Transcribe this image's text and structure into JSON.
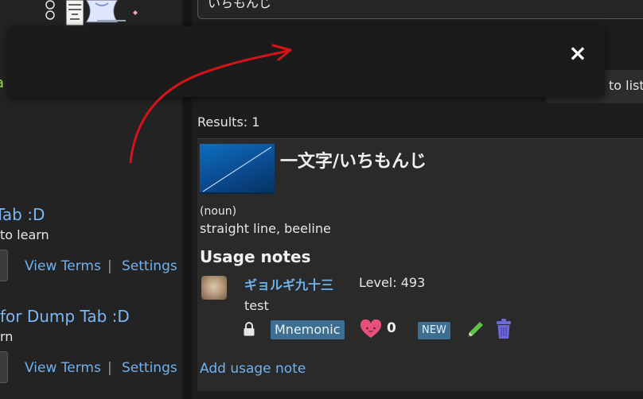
{
  "search": {
    "value": "いちもんじ"
  },
  "toast": {
    "close_label": "×"
  },
  "sidebar": {
    "partial_green_text": "a",
    "decks": [
      {
        "title": "Tab :D",
        "subtitle": "to learn",
        "view_terms": "View Terms",
        "separator": "|",
        "settings": "Settings"
      },
      {
        "title": "for Dump Tab :D",
        "subtitle": "rn",
        "view_terms": "View Terms",
        "separator": "|",
        "settings": "Settings"
      }
    ]
  },
  "toolbar": {
    "to_list_label": "to list"
  },
  "results": {
    "label": "Results: 1"
  },
  "entry": {
    "word": "一文字/いちもんじ",
    "part_of_speech": "(noun)",
    "meaning": "straight line, beeline",
    "usage_heading": "Usage notes",
    "note": {
      "username": "ギョルギ九十三",
      "level": "Level: 493",
      "text": "test",
      "tag": "Mnemonic",
      "likes": "0",
      "new_badge": "NEW"
    },
    "add_note_label": "Add usage note"
  },
  "colors": {
    "link": "#6fb2f0",
    "tag_bg": "#3d6f92",
    "heart": "#e6507a",
    "pencil": "#5fc24a",
    "trash": "#6d67d8",
    "arrow": "#d4141a",
    "green_text": "#9be052"
  },
  "icons": [
    "close-icon",
    "lock-icon",
    "heart-icon",
    "pencil-icon",
    "trash-icon",
    "arrow-annotation"
  ]
}
